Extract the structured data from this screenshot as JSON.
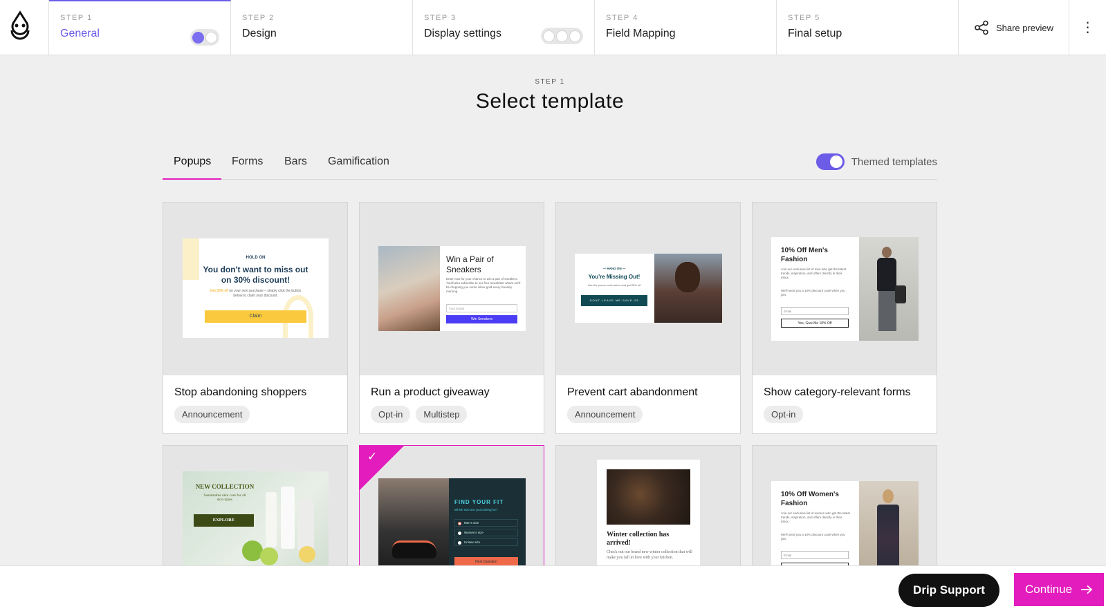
{
  "steps": [
    {
      "num": "STEP 1",
      "name": "General"
    },
    {
      "num": "STEP 2",
      "name": "Design"
    },
    {
      "num": "STEP 3",
      "name": "Display settings"
    },
    {
      "num": "STEP 4",
      "name": "Field Mapping"
    },
    {
      "num": "STEP 5",
      "name": "Final setup"
    }
  ],
  "header": {
    "share_label": "Share preview"
  },
  "page": {
    "step_label": "STEP 1",
    "title": "Select template"
  },
  "tabs": [
    "Popups",
    "Forms",
    "Bars",
    "Gamification"
  ],
  "themed_label": "Themed templates",
  "cards": [
    {
      "title": "Stop abandoning shoppers",
      "tags": [
        "Announcement"
      ]
    },
    {
      "title": "Run a product giveaway",
      "tags": [
        "Opt-in",
        "Multistep"
      ]
    },
    {
      "title": "Prevent cart abandonment",
      "tags": [
        "Announcement"
      ]
    },
    {
      "title": "Show category-relevant forms",
      "tags": [
        "Opt-in"
      ]
    }
  ],
  "previews": {
    "p1": {
      "kicker": "HOLD ON",
      "headline": "You don't want to miss out on 30% discount!",
      "body_accent": "Get 30% off",
      "body": "on your next purchase – simply click the button below to claim your discount.",
      "cta": "Claim"
    },
    "p2": {
      "headline": "Win a Pair of Sneakers",
      "body": "Enter now for your chance to win a pair of sneakers. You'll also subscribe to our free newsletter where we'll be dropping you some inbox gold every Sunday morning.",
      "email": "Your Email",
      "cta": "Win Sneakers"
    },
    "p3": {
      "kicker": "— HANG ON —",
      "headline": "You're Missing Out!",
      "body": "Use the promo code below and get 25% off",
      "code": "DONT-LEAVE-ME-SAVE-25"
    },
    "p4": {
      "headline": "10% Off Men's Fashion",
      "body": "Join our exclusive list of men who get the latest trends, inspiration, and offers directly in their inbox.",
      "body2": "We'll send you a 10% discount code when you join.",
      "email": "Email",
      "cta": "Yes, Give Me 10% Off"
    },
    "p5": {
      "headline": "NEW COLLECTION",
      "body": "Sustainable skin care for all skin types",
      "cta": "EXPLORE"
    },
    "p6": {
      "headline": "FIND YOUR FIT",
      "question": "Which size are you looking for?",
      "options": [
        "Men's size",
        "Women's size",
        "Unisex size"
      ],
      "cta": "Next Question"
    },
    "p7": {
      "headline": "Winter collection has arrived!",
      "body": "Check out our brand new winter collection that will make you fall in love with your kitchen."
    },
    "p8": {
      "headline": "10% Off Women's Fashion",
      "body": "Join our exclusive list of women who get the latest trends, inspiration, and offers directly in their inbox.",
      "body2": "We'll send you a 10% discount code when you join.",
      "email": "Email"
    }
  },
  "bottom": {
    "support": "Drip Support",
    "continue": "Continue"
  },
  "colors": {
    "accent": "#6c5ce7",
    "brand_pink": "#e31cbd"
  }
}
